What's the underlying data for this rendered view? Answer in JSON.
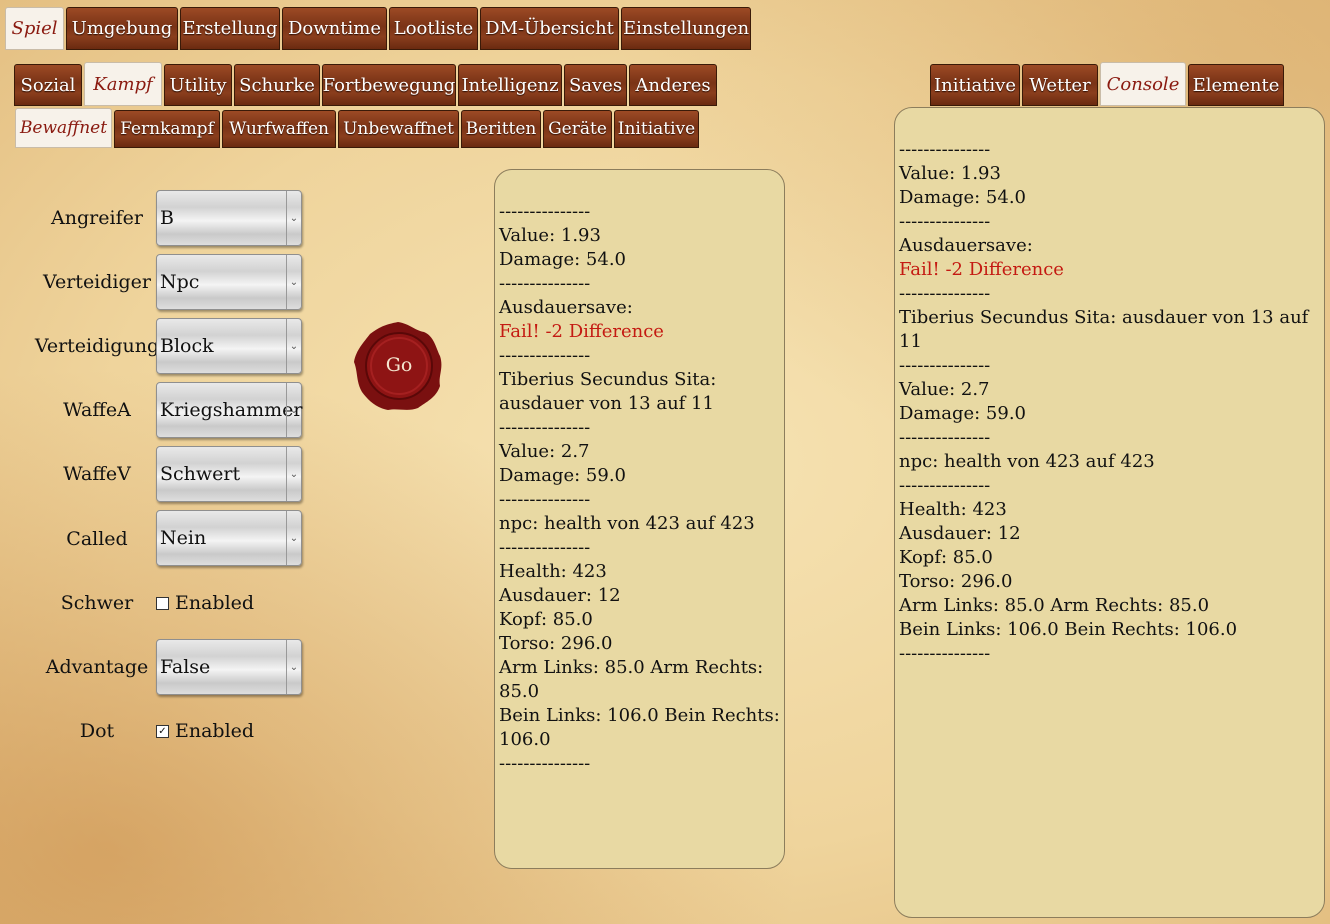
{
  "nav_main": {
    "tabs": [
      "Spiel",
      "Umgebung",
      "Erstellung",
      "Downtime",
      "Lootliste",
      "DM-Übersicht",
      "Einstellungen"
    ]
  },
  "nav_category": {
    "tabs": [
      "Sozial",
      "Kampf",
      "Utility",
      "Schurke",
      "Fortbewegung",
      "Intelligenz",
      "Saves",
      "Anderes"
    ]
  },
  "nav_sub": {
    "tabs": [
      "Bewaffnet",
      "Fernkampf",
      "Wurfwaffen",
      "Unbewaffnet",
      "Beritten",
      "Geräte",
      "Initiative"
    ]
  },
  "nav_right": {
    "tabs": [
      "Initiative",
      "Wetter",
      "Console",
      "Elemente"
    ]
  },
  "form": {
    "angreifer": {
      "label": "Angreifer",
      "value": "B"
    },
    "verteidiger": {
      "label": "Verteidiger",
      "value": "Npc"
    },
    "verteidigung": {
      "label": "Verteidigung",
      "value": "Block"
    },
    "waffea": {
      "label": "WaffeA",
      "value": "Kriegshammer"
    },
    "waffev": {
      "label": "WaffeV",
      "value": "Schwert"
    },
    "called": {
      "label": "Called",
      "value": "Nein"
    },
    "schwer": {
      "label": "Schwer",
      "checkbox_label": "Enabled",
      "checked": false
    },
    "advantage": {
      "label": "Advantage",
      "value": "False"
    },
    "dot": {
      "label": "Dot",
      "checkbox_label": "Enabled",
      "checked": true
    }
  },
  "go_button": {
    "label": "Go"
  },
  "result_log": [
    {
      "text": "---------------"
    },
    {
      "text": "Value: 1.93"
    },
    {
      "text": "Damage: 54.0"
    },
    {
      "text": "---------------"
    },
    {
      "text": "Ausdauersave:"
    },
    {
      "text": "Fail! -2 Difference",
      "red": true
    },
    {
      "text": "---------------"
    },
    {
      "text": "Tiberius Secundus Sita: ausdauer von 13 auf 11"
    },
    {
      "text": "---------------"
    },
    {
      "text": "Value: 2.7"
    },
    {
      "text": "Damage: 59.0"
    },
    {
      "text": "---------------"
    },
    {
      "text": "npc: health von 423 auf 423"
    },
    {
      "text": "---------------"
    },
    {
      "text": "Health: 423"
    },
    {
      "text": "Ausdauer: 12"
    },
    {
      "text": "Kopf: 85.0"
    },
    {
      "text": "Torso: 296.0"
    },
    {
      "text": "Arm Links: 85.0 Arm Rechts: 85.0"
    },
    {
      "text": "Bein Links: 106.0 Bein Rechts: 106.0"
    },
    {
      "text": "---------------"
    }
  ],
  "console_log": [
    {
      "text": "---------------"
    },
    {
      "text": "Value: 1.93"
    },
    {
      "text": "Damage: 54.0"
    },
    {
      "text": "---------------"
    },
    {
      "text": "Ausdauersave:"
    },
    {
      "text": "Fail! -2 Difference",
      "red": true
    },
    {
      "text": "---------------"
    },
    {
      "text": "Tiberius Secundus Sita: ausdauer von 13 auf 11"
    },
    {
      "text": "---------------"
    },
    {
      "text": "Value: 2.7"
    },
    {
      "text": "Damage: 59.0"
    },
    {
      "text": "---------------"
    },
    {
      "text": "npc: health von 423 auf 423"
    },
    {
      "text": "---------------"
    },
    {
      "text": "Health: 423"
    },
    {
      "text": "Ausdauer: 12"
    },
    {
      "text": "Kopf: 85.0"
    },
    {
      "text": "Torso: 296.0"
    },
    {
      "text": "Arm Links: 85.0 Arm Rechts: 85.0"
    },
    {
      "text": "Bein Links: 106.0 Bein Rechts: 106.0"
    },
    {
      "text": "---------------"
    }
  ],
  "colors": {
    "tab_wood": "#7a3316",
    "active_text": "#8a1a10",
    "panel_bg": "#e8d9a3",
    "fail_red": "#c41a12",
    "seal": "#8e1414"
  }
}
